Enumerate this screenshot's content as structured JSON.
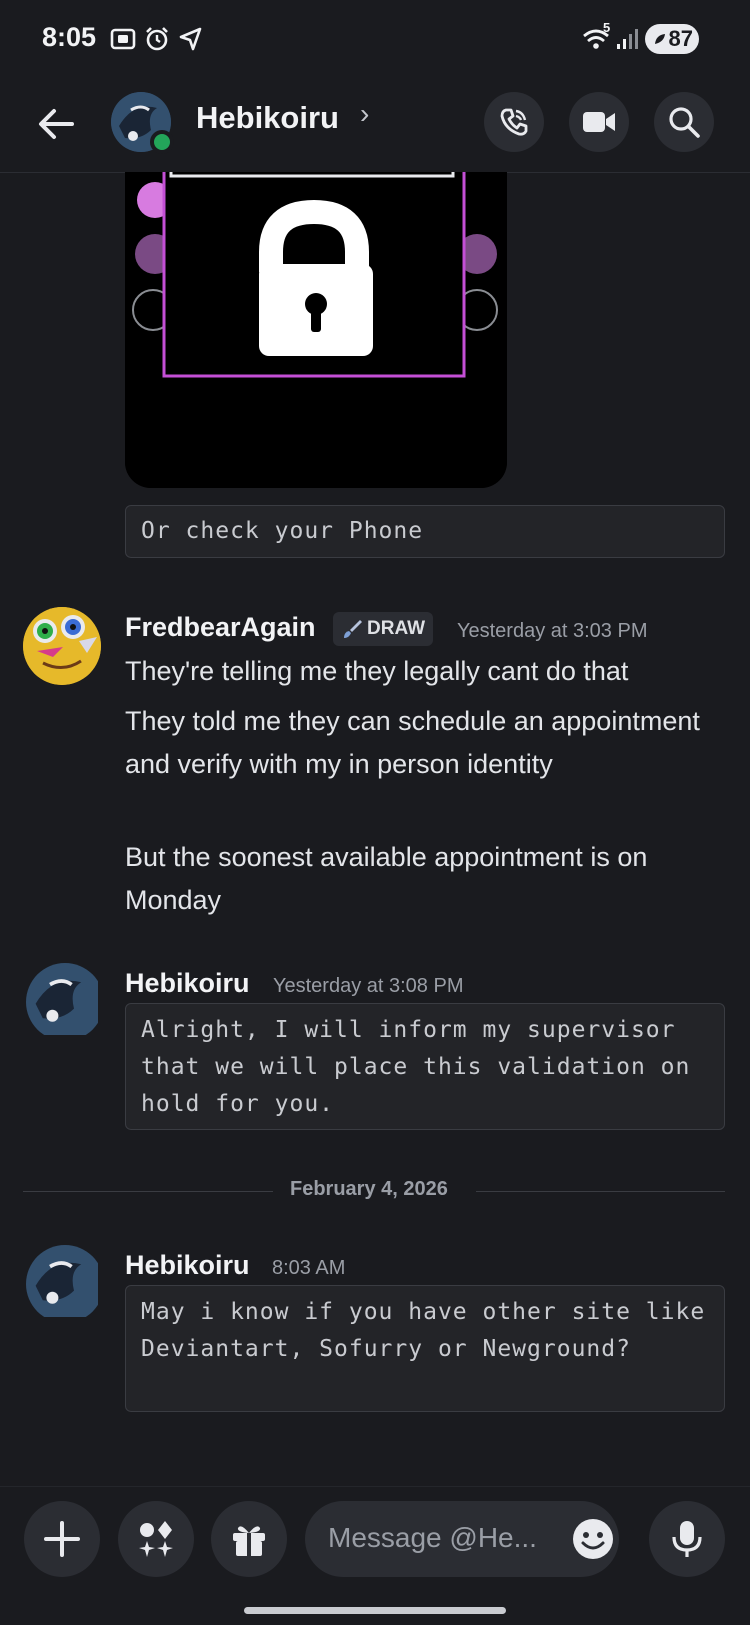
{
  "status_bar": {
    "time": "8:05",
    "signal_label": "5",
    "battery": "87",
    "icons": [
      "screen-record-icon",
      "alarm-icon",
      "location-icon",
      "wifi-icon",
      "cell-signal-icon"
    ]
  },
  "header": {
    "name": "Hebikoiru",
    "chevron": "›",
    "icons": [
      "back-arrow-icon",
      "voice-call-icon",
      "video-call-icon",
      "search-icon"
    ]
  },
  "embed": {
    "code_text": "Or check your Phone"
  },
  "messages": [
    {
      "username": "FredbearAgain",
      "tag": "DRAW",
      "timestamp": "Yesterday at 3:03 PM",
      "lines": [
        "They're telling me they legally cant do that",
        "They told me they can schedule an appointment and verify with my in person identity",
        "But the soonest available appointment is on Monday"
      ]
    },
    {
      "username": "Hebikoiru",
      "timestamp": "Yesterday at 3:08 PM",
      "code": "Alright, I will inform my supervisor that we will place this validation on hold for you."
    },
    {
      "username": "Hebikoiru",
      "timestamp": "8:03 AM",
      "code": "May i know if you have other site like Deviantart, Sofurry or Newground?"
    }
  ],
  "date_divider": "February 4, 2026",
  "composer": {
    "placeholder": "Message @He...",
    "icons": [
      "plus-icon",
      "apps-icon",
      "gift-icon",
      "emoji-icon",
      "microphone-icon"
    ]
  },
  "colors": {
    "background": "#1a1b1f",
    "surface": "#2b2d33",
    "online": "#23a55a",
    "embed_border": "#b044c8"
  }
}
